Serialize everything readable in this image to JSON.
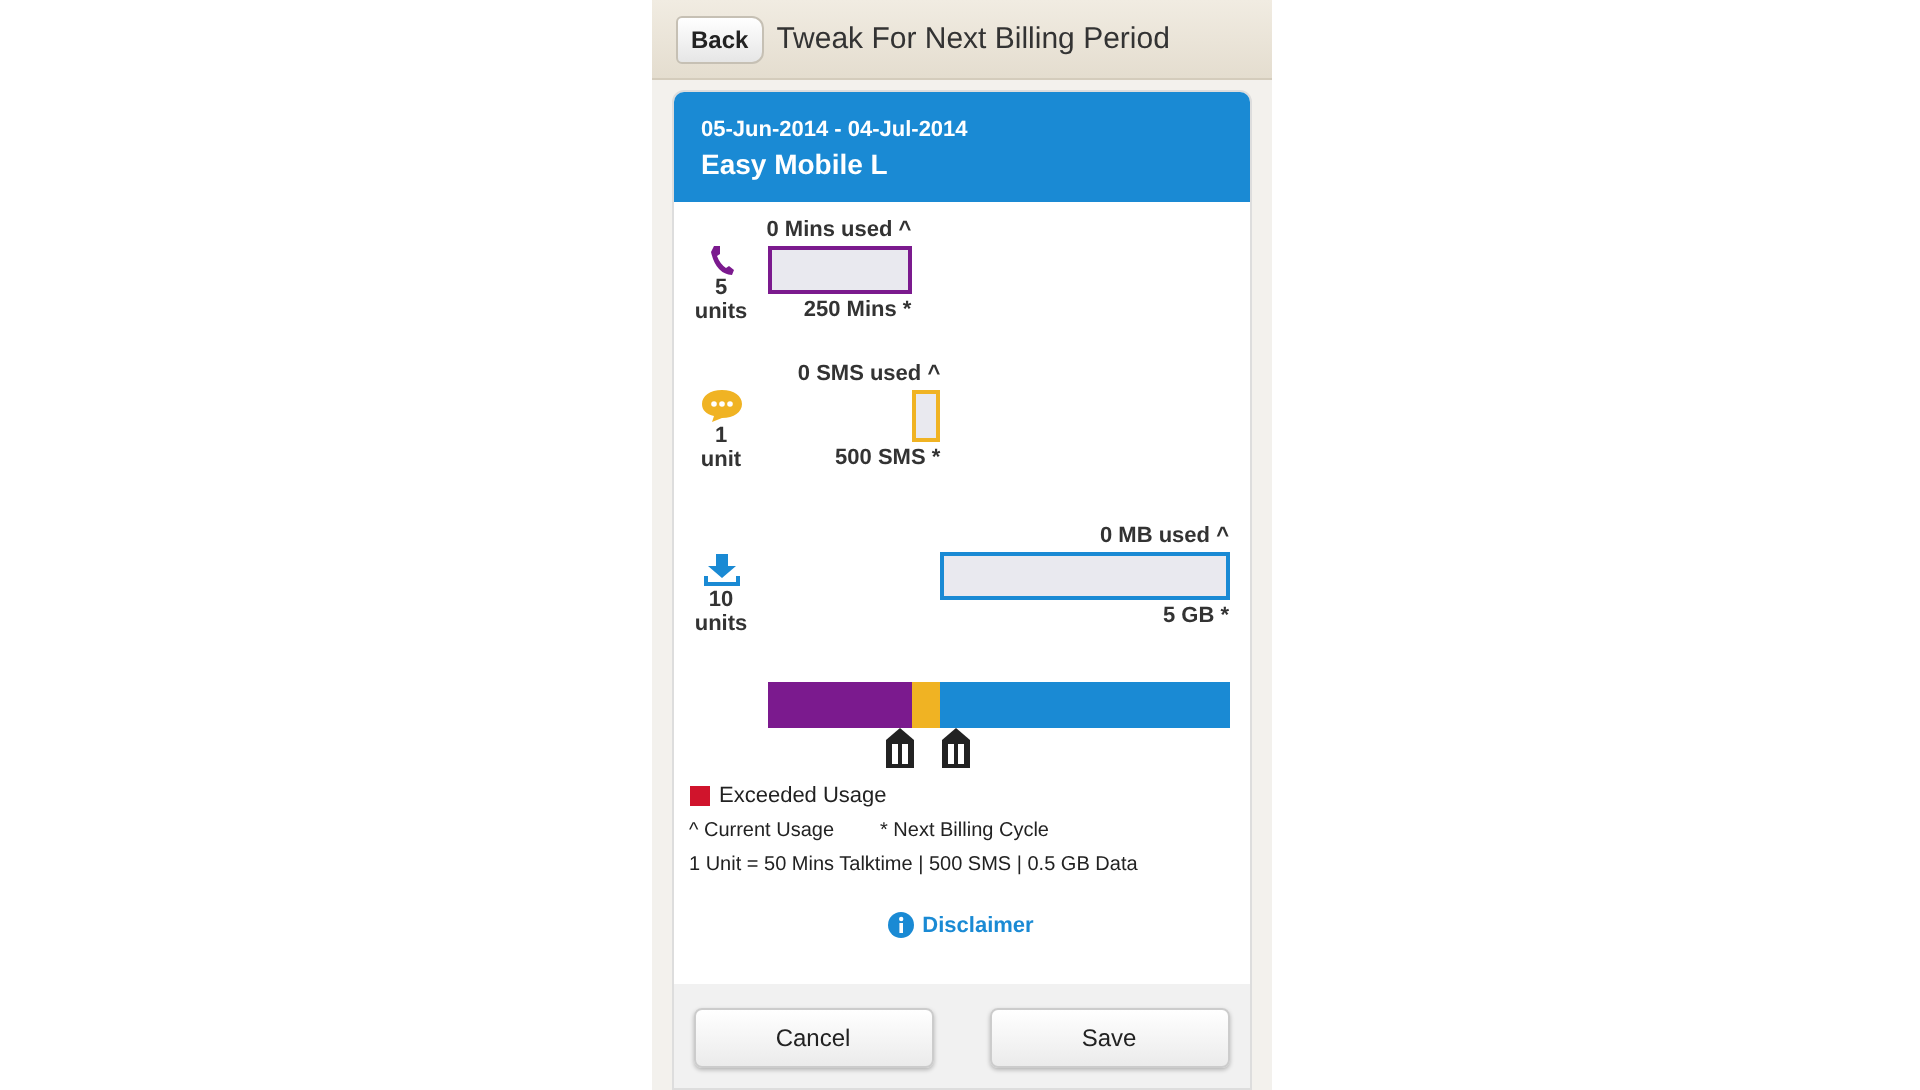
{
  "nav_bar": {
    "back_label": "Back",
    "title": "Tweak For Next Billing Period"
  },
  "plan": {
    "period": "05-Jun-2014 - 04-Jul-2014",
    "name": "Easy Mobile L"
  },
  "usage_rows": [
    {
      "kind": "voice",
      "units": "5",
      "unit_label": "units",
      "used": "0 Mins used ^",
      "allowance": "250 Mins *",
      "color": "#7b1a8e"
    },
    {
      "kind": "sms",
      "units": "1",
      "unit_label": "unit",
      "used": "0 SMS used ^",
      "allowance": "500 SMS *",
      "color": "#f0b323"
    },
    {
      "kind": "data",
      "units": "10",
      "unit_label": "units",
      "used": "0 MB used ^",
      "allowance": "5 GB *",
      "color": "#1a8ad4"
    }
  ],
  "legend": {
    "exceeded": "Exceeded Usage",
    "current": "^ Current Usage",
    "next_cycle": "* Next Billing Cycle",
    "unit_note": "1 Unit = 50 Mins Talktime | 500 SMS | 0.5 GB Data"
  },
  "disclaimer": "Disclaimer",
  "buttons": [
    {
      "label": "Cancel"
    },
    {
      "label": "Save"
    }
  ]
}
